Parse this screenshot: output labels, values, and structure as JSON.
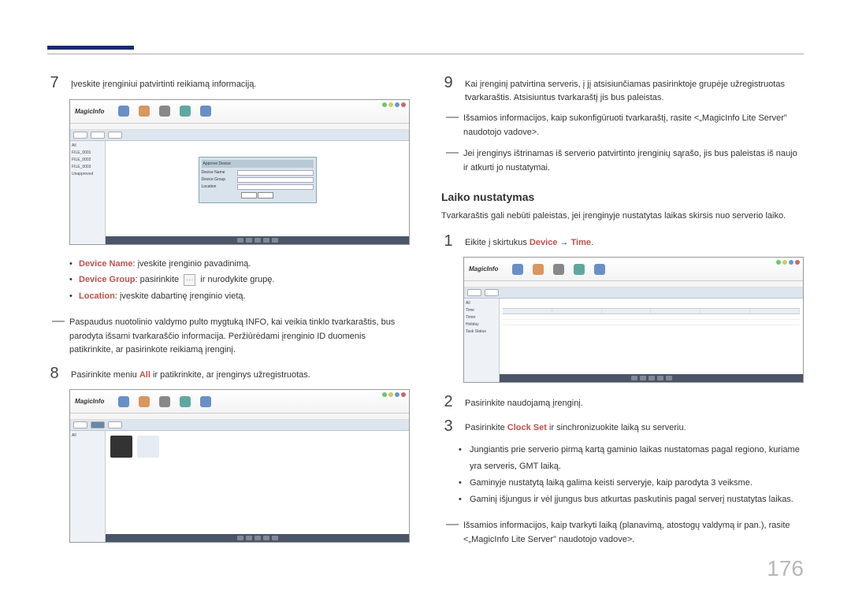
{
  "page_number": "176",
  "app_logo": "MagicInfo",
  "left": {
    "step7": {
      "num": "7",
      "text": "Įveskite įrenginiui patvirtinti reikiamą informaciją."
    },
    "bullets": {
      "device_name_label": "Device Name",
      "device_name_text": ": įveskite įrenginio pavadinimą.",
      "device_group_label": "Device Group",
      "device_group_text_before": ": pasirinkite",
      "device_group_text_after": "ir nurodykite grupę.",
      "location_label": "Location",
      "location_text": ": įveskite dabartinę įrenginio vietą."
    },
    "note7": "Paspaudus nuotolinio valdymo pulto mygtuką INFO, kai veikia tinklo tvarkaraštis, bus parodyta išsami tvarkaraščio informacija. Peržiūrėdami įrenginio ID duomenis patikrinkite, ar pasirinkote reikiamą įrenginį.",
    "step8": {
      "num": "8",
      "text_before": "Pasirinkite meniu ",
      "all": "All",
      "text_after": " ir patikrinkite, ar įrenginys užregistruotas."
    },
    "sidebar_items": [
      "All",
      "FILE_0001",
      "FILE_0002",
      "FILE_0003",
      "Unapproved"
    ],
    "dialog": {
      "title": "Approve Device",
      "f1": "Device Name",
      "f2": "Device Group",
      "f3": "Location"
    }
  },
  "right": {
    "step9": {
      "num": "9",
      "text": "Kai įrenginį patvirtina serveris, į jį atsisiunčiamas pasirinktoje grupėje užregistruotas tvarkaraštis. Atsisiuntus tvarkaraštį jis bus paleistas."
    },
    "note9a": "Išsamios informacijos, kaip sukonfigūruoti tvarkaraštį, rasite <„MagicInfo Lite Server\" naudotojo vadove>.",
    "note9b": "Jei įrenginys ištrinamas iš serverio patvirtinto įrenginių sąrašo, jis bus paleistas iš naujo ir atkurti jo nustatymai.",
    "heading": "Laiko nustatymas",
    "intro": "Tvarkaraštis gali nebūti paleistas, jei įrenginyje nustatytas laikas skirsis nuo serverio laiko.",
    "step1": {
      "num": "1",
      "text_before": "Eikite į skirtukus ",
      "device": "Device",
      "arrow": " → ",
      "time": "Time",
      "text_after": "."
    },
    "sidebar_items": [
      "All",
      "Time",
      "Timer",
      "Holiday",
      "Task Status"
    ],
    "step2": {
      "num": "2",
      "text": "Pasirinkite naudojamą įrenginį."
    },
    "step3": {
      "num": "3",
      "text_before": "Pasirinkite ",
      "clock_set": "Clock Set",
      "text_after": " ir sinchronizuokite laiką su serveriu."
    },
    "bullets": {
      "b1": "Jungiantis prie serverio pirmą kartą gaminio laikas nustatomas pagal regiono, kuriame yra serveris, GMT laiką.",
      "b2": "Gaminyje nustatytą laiką galima keisti serveryje, kaip parodyta 3 veiksme.",
      "b3": "Gaminį išjungus ir vėl įjungus bus atkurtas paskutinis pagal serverį nustatytas laikas."
    },
    "note_end": "Išsamios informacijos, kaip tvarkyti laiką (planavimą, atostogų valdymą ir pan.), rasite <„MagicInfo Lite Server\" naudotojo vadove>."
  }
}
